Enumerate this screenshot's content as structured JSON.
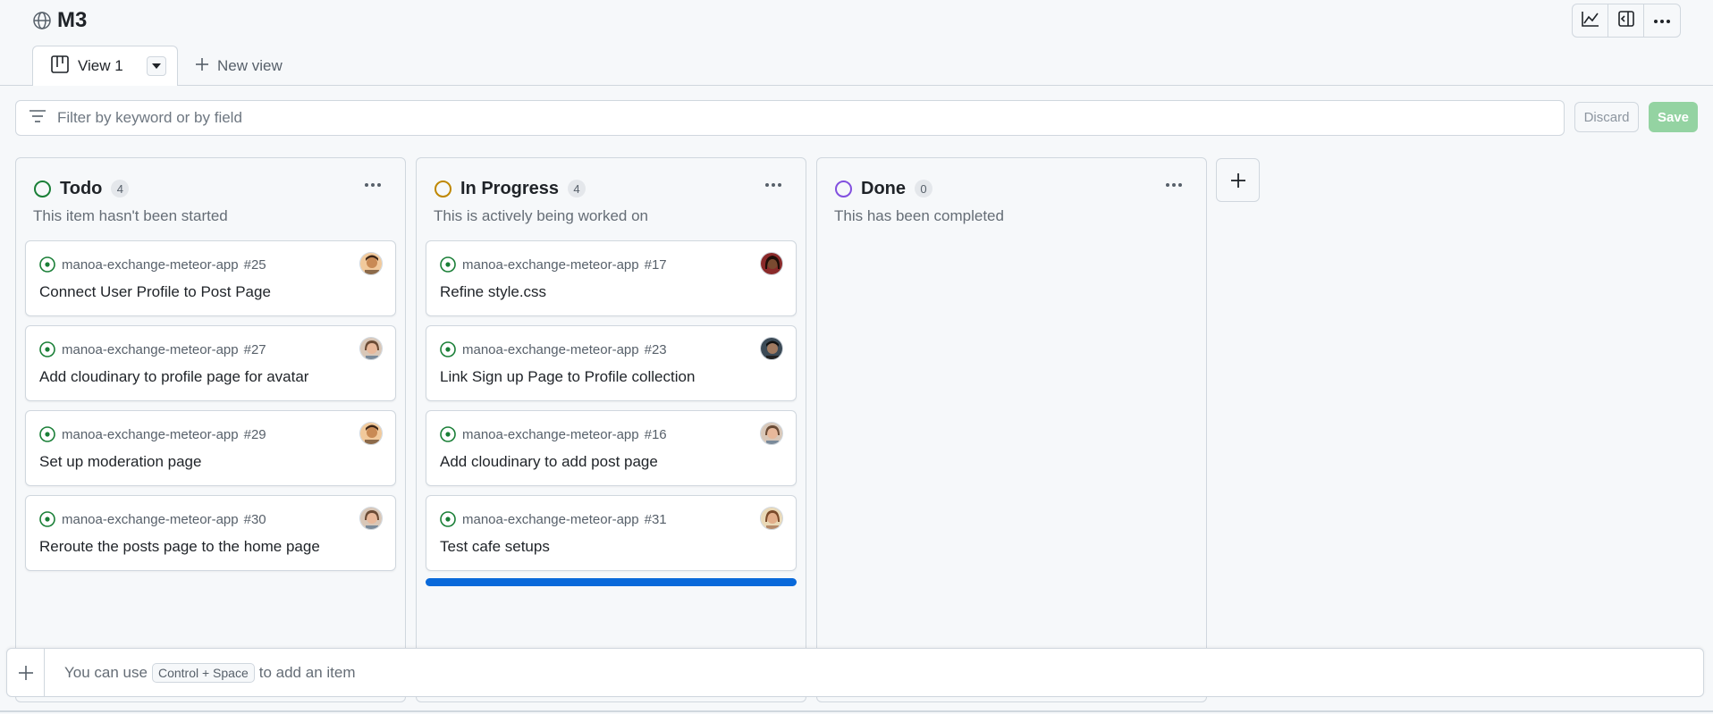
{
  "project": {
    "title": "M3",
    "icon": "globe-icon"
  },
  "toolbar": {
    "icons": [
      "chart-icon",
      "sidebar-icon",
      "kebab-icon"
    ]
  },
  "views": {
    "active_tab": "View 1",
    "new_view_label": "New view"
  },
  "filter": {
    "placeholder": "Filter by keyword or by field",
    "value": "",
    "discard_label": "Discard",
    "save_label": "Save"
  },
  "colors": {
    "todo": "#1a7f37",
    "in_progress": "#bf8700",
    "done": "#8250df",
    "drop_indicator": "#0969da",
    "save_bg": "#94d3a2"
  },
  "columns": [
    {
      "title": "Todo",
      "count": "4",
      "description": "This item hasn't been started",
      "status_color": "#1a7f37",
      "cards": [
        {
          "repo": "manoa-exchange-meteor-app",
          "number": "#25",
          "title": "Connect User Profile to Post Page",
          "avatar": "avatar-a"
        },
        {
          "repo": "manoa-exchange-meteor-app",
          "number": "#27",
          "title": "Add cloudinary to profile page for avatar",
          "avatar": "avatar-b"
        },
        {
          "repo": "manoa-exchange-meteor-app",
          "number": "#29",
          "title": "Set up moderation page",
          "avatar": "avatar-a"
        },
        {
          "repo": "manoa-exchange-meteor-app",
          "number": "#30",
          "title": "Reroute the posts page to the home page",
          "avatar": "avatar-b"
        }
      ]
    },
    {
      "title": "In Progress",
      "count": "4",
      "description": "This is actively being worked on",
      "status_color": "#bf8700",
      "cards": [
        {
          "repo": "manoa-exchange-meteor-app",
          "number": "#17",
          "title": "Refine style.css",
          "avatar": "avatar-c"
        },
        {
          "repo": "manoa-exchange-meteor-app",
          "number": "#23",
          "title": "Link Sign up Page to Profile collection",
          "avatar": "avatar-d"
        },
        {
          "repo": "manoa-exchange-meteor-app",
          "number": "#16",
          "title": "Add cloudinary to add post page",
          "avatar": "avatar-b"
        },
        {
          "repo": "manoa-exchange-meteor-app",
          "number": "#31",
          "title": "Test cafe setups",
          "avatar": "avatar-e"
        }
      ]
    },
    {
      "title": "Done",
      "count": "0",
      "description": "This has been completed",
      "status_color": "#8250df",
      "cards": []
    }
  ],
  "add_item": {
    "prefix": "You can use",
    "shortcut": "Control + Space",
    "suffix": "to add an item"
  }
}
